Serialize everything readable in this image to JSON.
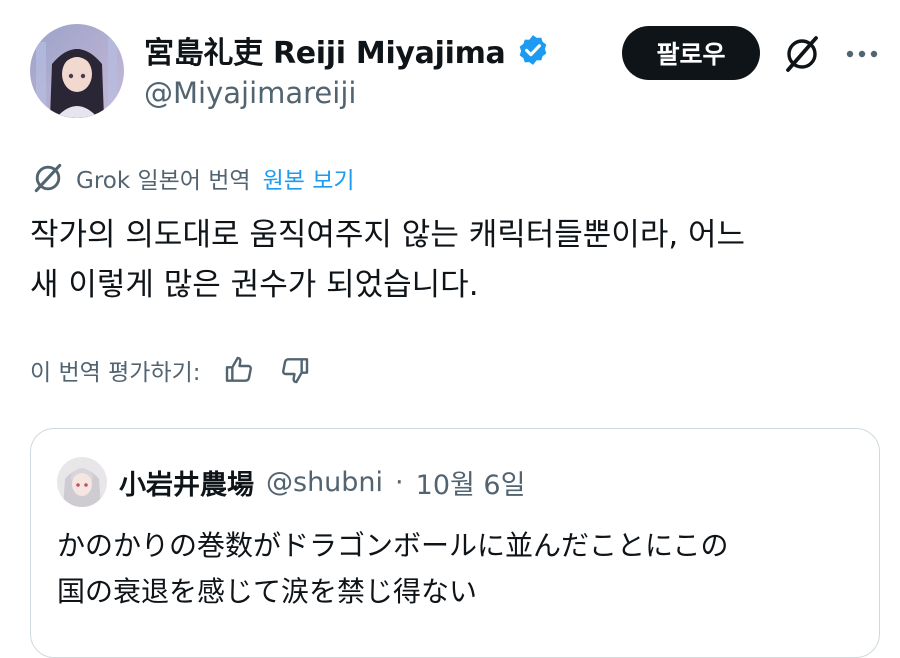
{
  "post": {
    "author": {
      "display_name": "宮島礼吏 Reiji Miyajima",
      "handle": "@Miyajimareiji",
      "avatar_icon": "anime-girl-avatar",
      "verified": true,
      "verified_color": "#1d9bf0"
    },
    "follow_label": "팔로우",
    "translation": {
      "label": "Grok 일본어 번역",
      "view_original": "원본 보기"
    },
    "text_lines": [
      "작가의 의도대로 움직여주지 않는 캐릭터들뿐이라, 어느",
      "새 이렇게 많은 권수가 되었습니다."
    ],
    "rate": {
      "label": "이 번역 평가하기:"
    }
  },
  "quote": {
    "author": {
      "display_name": "小岩井農場",
      "handle": "@shubni",
      "avatar_icon": "silver-hair-avatar"
    },
    "separator": "·",
    "date": "10월 6일",
    "text_lines": [
      "かのかりの巻数がドラゴンボールに並んだことにこの",
      "国の衰退を感じて涙を禁じ得ない"
    ]
  },
  "colors": {
    "text_primary": "#0f1419",
    "text_secondary": "#536471",
    "accent": "#1d9bf0",
    "follow_button_bg": "#0f1419",
    "border": "#cfd9de"
  }
}
